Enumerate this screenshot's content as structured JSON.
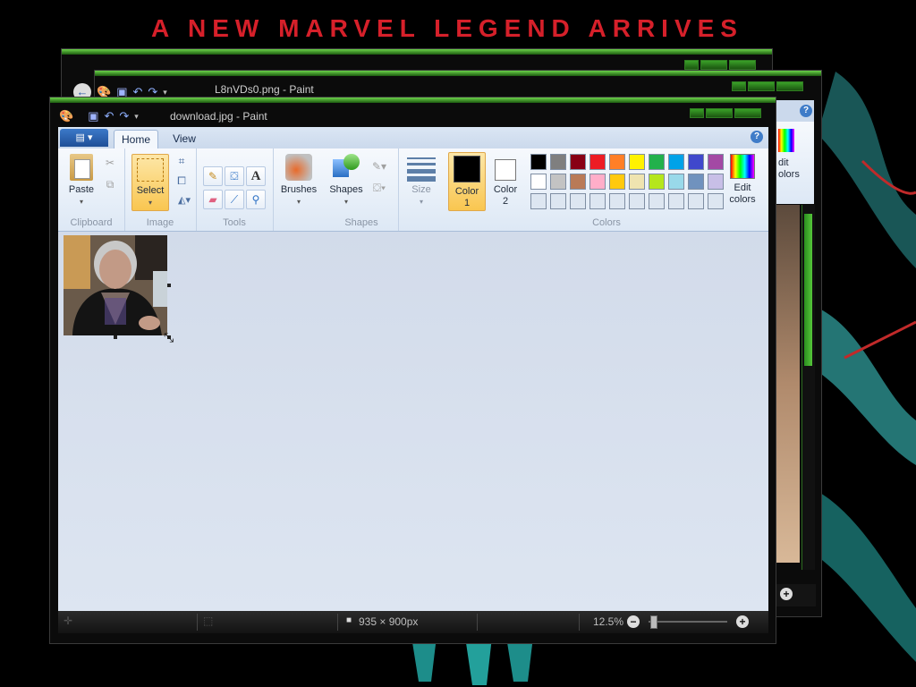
{
  "desktop": {
    "banner": "A NEW MARVEL LEGEND ARRIVES"
  },
  "back_window": {
    "title": "L8nVDs0.png - Paint",
    "edit_colors_label": "dit\nolors"
  },
  "front_window": {
    "title": "download.jpg - Paint",
    "tabs": [
      "Home",
      "View"
    ],
    "groups": {
      "clipboard": {
        "label": "Clipboard",
        "paste": "Paste"
      },
      "image": {
        "label": "Image",
        "select": "Select"
      },
      "tools": {
        "label": "Tools"
      },
      "brushes": {
        "label": "Brushes"
      },
      "shapes": {
        "label": "Shapes",
        "shapes_btn": "Shapes"
      },
      "size": {
        "label": "Size"
      },
      "colors": {
        "label": "Colors",
        "color1": "Color\n1",
        "color2": "Color\n2",
        "edit_colors": "Edit\ncolors",
        "color1_value": "#000000",
        "color2_value": "#ffffff",
        "palette_row1": [
          "#000000",
          "#7f7f7f",
          "#880015",
          "#ed1c24",
          "#ff7f27",
          "#fff200",
          "#22b14c",
          "#00a2e8",
          "#3f48cc",
          "#a349a4"
        ],
        "palette_row2": [
          "#ffffff",
          "#c3c3c3",
          "#b97a57",
          "#ffaec9",
          "#ffc90e",
          "#efe4b0",
          "#b5e61d",
          "#99d9ea",
          "#7092be",
          "#c8bfe7"
        ],
        "palette_row3": [
          "#dde6f1",
          "#dde6f1",
          "#dde6f1",
          "#dde6f1",
          "#dde6f1",
          "#dde6f1",
          "#dde6f1",
          "#dde6f1",
          "#dde6f1",
          "#dde6f1"
        ]
      }
    },
    "status": {
      "dimensions": "935 × 900px",
      "zoom": "12.5%"
    }
  },
  "icons": {
    "cut": "scissors-icon",
    "copy": "copy-icon",
    "pencil": "pencil-icon",
    "fill": "fill-bucket-icon",
    "text": "text-icon",
    "eraser": "eraser-icon",
    "picker": "color-picker-icon",
    "magnifier": "magnifier-icon"
  }
}
